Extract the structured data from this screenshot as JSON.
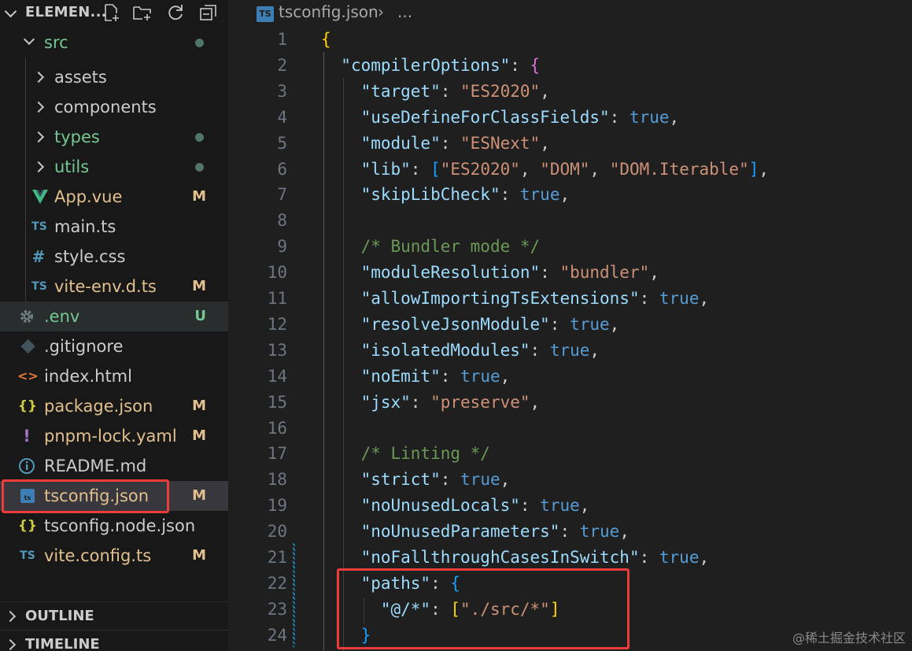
{
  "explorer": {
    "title": "ELEMEN...",
    "actions": [
      "new-file-icon",
      "new-folder-icon",
      "refresh-icon",
      "collapse-all-icon"
    ]
  },
  "tree": [
    {
      "name": "src",
      "kind": "folder-open",
      "status": "dot",
      "color": "#73c991"
    },
    {
      "name": "assets",
      "kind": "folder",
      "status": "",
      "color": "#cccccc"
    },
    {
      "name": "components",
      "kind": "folder",
      "status": "",
      "color": "#cccccc"
    },
    {
      "name": "types",
      "kind": "folder",
      "status": "dot",
      "color": "#73c991"
    },
    {
      "name": "utils",
      "kind": "folder",
      "status": "dot",
      "color": "#73c991"
    },
    {
      "name": "App.vue",
      "kind": "vue",
      "status": "M",
      "color": "#e2c08d"
    },
    {
      "name": "main.ts",
      "kind": "ts",
      "status": "",
      "color": "#cccccc"
    },
    {
      "name": "style.css",
      "kind": "css",
      "status": "",
      "color": "#cccccc"
    },
    {
      "name": "vite-env.d.ts",
      "kind": "ts",
      "status": "M",
      "color": "#e2c08d"
    },
    {
      "name": ".env",
      "kind": "env",
      "status": "U",
      "color": "#73c991"
    },
    {
      "name": ".gitignore",
      "kind": "git",
      "status": "",
      "color": "#cccccc"
    },
    {
      "name": "index.html",
      "kind": "html",
      "status": "",
      "color": "#cccccc"
    },
    {
      "name": "package.json",
      "kind": "json",
      "status": "M",
      "color": "#e2c08d"
    },
    {
      "name": "pnpm-lock.yaml",
      "kind": "yaml",
      "status": "M",
      "color": "#e2c08d"
    },
    {
      "name": "README.md",
      "kind": "info",
      "status": "",
      "color": "#cccccc"
    },
    {
      "name": "tsconfig.json",
      "kind": "tsconfig",
      "status": "M",
      "color": "#e2c08d"
    },
    {
      "name": "tsconfig.node.json",
      "kind": "json",
      "status": "",
      "color": "#cccccc"
    },
    {
      "name": "vite.config.ts",
      "kind": "ts",
      "status": "M",
      "color": "#e2c08d"
    }
  ],
  "sections": [
    "OUTLINE",
    "TIMELINE"
  ],
  "breadcrumb": {
    "icon": "TS",
    "file": "tsconfig.json",
    "sep": "›",
    "more": "..."
  },
  "editor": {
    "lines": [
      {
        "n": "1",
        "t": [
          [
            "y",
            "{"
          ]
        ]
      },
      {
        "n": "2",
        "t": [
          [
            "p",
            "  "
          ],
          [
            "k",
            "\"compilerOptions\""
          ],
          [
            "p",
            ": "
          ],
          [
            "m",
            "{"
          ]
        ]
      },
      {
        "n": "3",
        "t": [
          [
            "p",
            "    "
          ],
          [
            "k",
            "\"target\""
          ],
          [
            "p",
            ": "
          ],
          [
            "s",
            "\"ES2020\""
          ],
          [
            "p",
            ","
          ]
        ]
      },
      {
        "n": "4",
        "t": [
          [
            "p",
            "    "
          ],
          [
            "k",
            "\"useDefineForClassFields\""
          ],
          [
            "p",
            ": "
          ],
          [
            "b",
            "true"
          ],
          [
            "p",
            ","
          ]
        ]
      },
      {
        "n": "5",
        "t": [
          [
            "p",
            "    "
          ],
          [
            "k",
            "\"module\""
          ],
          [
            "p",
            ": "
          ],
          [
            "s",
            "\"ESNext\""
          ],
          [
            "p",
            ","
          ]
        ]
      },
      {
        "n": "6",
        "t": [
          [
            "p",
            "    "
          ],
          [
            "k",
            "\"lib\""
          ],
          [
            "p",
            ": "
          ],
          [
            "bl",
            "["
          ],
          [
            "s",
            "\"ES2020\""
          ],
          [
            "p",
            ", "
          ],
          [
            "s",
            "\"DOM\""
          ],
          [
            "p",
            ", "
          ],
          [
            "s",
            "\"DOM.Iterable\""
          ],
          [
            "bl",
            "]"
          ],
          [
            "p",
            ","
          ]
        ]
      },
      {
        "n": "7",
        "t": [
          [
            "p",
            "    "
          ],
          [
            "k",
            "\"skipLibCheck\""
          ],
          [
            "p",
            ": "
          ],
          [
            "b",
            "true"
          ],
          [
            "p",
            ","
          ]
        ]
      },
      {
        "n": "8",
        "t": []
      },
      {
        "n": "9",
        "t": [
          [
            "p",
            "    "
          ],
          [
            "c",
            "/* Bundler mode */"
          ]
        ]
      },
      {
        "n": "10",
        "t": [
          [
            "p",
            "    "
          ],
          [
            "k",
            "\"moduleResolution\""
          ],
          [
            "p",
            ": "
          ],
          [
            "s",
            "\"bundler\""
          ],
          [
            "p",
            ","
          ]
        ]
      },
      {
        "n": "11",
        "t": [
          [
            "p",
            "    "
          ],
          [
            "k",
            "\"allowImportingTsExtensions\""
          ],
          [
            "p",
            ": "
          ],
          [
            "b",
            "true"
          ],
          [
            "p",
            ","
          ]
        ]
      },
      {
        "n": "12",
        "t": [
          [
            "p",
            "    "
          ],
          [
            "k",
            "\"resolveJsonModule\""
          ],
          [
            "p",
            ": "
          ],
          [
            "b",
            "true"
          ],
          [
            "p",
            ","
          ]
        ]
      },
      {
        "n": "13",
        "t": [
          [
            "p",
            "    "
          ],
          [
            "k",
            "\"isolatedModules\""
          ],
          [
            "p",
            ": "
          ],
          [
            "b",
            "true"
          ],
          [
            "p",
            ","
          ]
        ]
      },
      {
        "n": "14",
        "t": [
          [
            "p",
            "    "
          ],
          [
            "k",
            "\"noEmit\""
          ],
          [
            "p",
            ": "
          ],
          [
            "b",
            "true"
          ],
          [
            "p",
            ","
          ]
        ]
      },
      {
        "n": "15",
        "t": [
          [
            "p",
            "    "
          ],
          [
            "k",
            "\"jsx\""
          ],
          [
            "p",
            ": "
          ],
          [
            "s",
            "\"preserve\""
          ],
          [
            "p",
            ","
          ]
        ]
      },
      {
        "n": "16",
        "t": []
      },
      {
        "n": "17",
        "t": [
          [
            "p",
            "    "
          ],
          [
            "c",
            "/* Linting */"
          ]
        ]
      },
      {
        "n": "18",
        "t": [
          [
            "p",
            "    "
          ],
          [
            "k",
            "\"strict\""
          ],
          [
            "p",
            ": "
          ],
          [
            "b",
            "true"
          ],
          [
            "p",
            ","
          ]
        ]
      },
      {
        "n": "19",
        "t": [
          [
            "p",
            "    "
          ],
          [
            "k",
            "\"noUnusedLocals\""
          ],
          [
            "p",
            ": "
          ],
          [
            "b",
            "true"
          ],
          [
            "p",
            ","
          ]
        ]
      },
      {
        "n": "20",
        "t": [
          [
            "p",
            "    "
          ],
          [
            "k",
            "\"noUnusedParameters\""
          ],
          [
            "p",
            ": "
          ],
          [
            "b",
            "true"
          ],
          [
            "p",
            ","
          ]
        ]
      },
      {
        "n": "21",
        "t": [
          [
            "p",
            "    "
          ],
          [
            "k",
            "\"noFallthroughCasesInSwitch\""
          ],
          [
            "p",
            ": "
          ],
          [
            "b",
            "true"
          ],
          [
            "p",
            ","
          ]
        ]
      },
      {
        "n": "22",
        "t": [
          [
            "p",
            "    "
          ],
          [
            "k",
            "\"paths\""
          ],
          [
            "p",
            ": "
          ],
          [
            "bl",
            "{"
          ]
        ]
      },
      {
        "n": "23",
        "t": [
          [
            "p",
            "      "
          ],
          [
            "k",
            "\"@/*\""
          ],
          [
            "p",
            ": "
          ],
          [
            "y",
            "["
          ],
          [
            "s",
            "\"./src/*\""
          ],
          [
            "y",
            "]"
          ]
        ]
      },
      {
        "n": "24",
        "t": [
          [
            "p",
            "    "
          ],
          [
            "bl",
            "}"
          ]
        ]
      }
    ]
  },
  "watermark": "@稀土掘金技术社区"
}
